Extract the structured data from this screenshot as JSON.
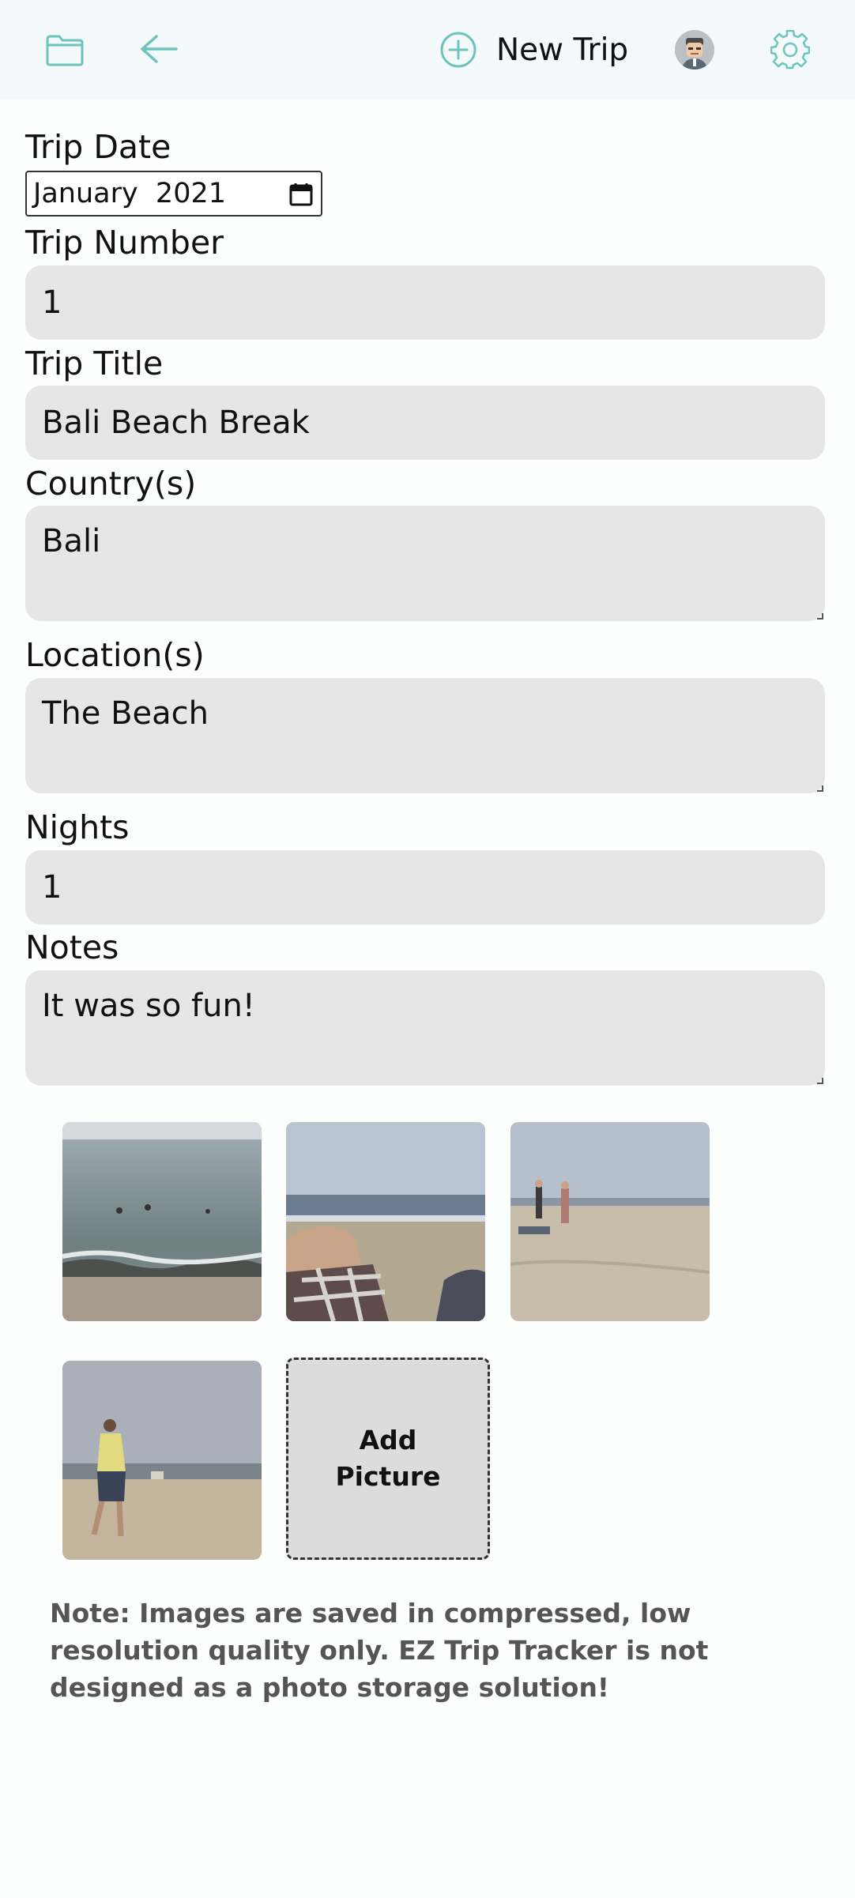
{
  "header": {
    "new_trip_label": "New Trip",
    "icons": [
      "folder-icon",
      "back-arrow-icon",
      "plus-circle-icon",
      "avatar",
      "gear-icon"
    ],
    "accent_color": "#6cc4bd"
  },
  "form": {
    "trip_date": {
      "label": "Trip Date",
      "value": "January  2021"
    },
    "trip_number": {
      "label": "Trip Number",
      "value": "1"
    },
    "trip_title": {
      "label": "Trip Title",
      "value": "Bali Beach Break"
    },
    "countries": {
      "label": "Country(s)",
      "value": "Bali"
    },
    "locations": {
      "label": "Location(s)",
      "value": "The Beach"
    },
    "nights": {
      "label": "Nights",
      "value": "1"
    },
    "notes": {
      "label": "Notes",
      "value": "It was so fun!"
    }
  },
  "gallery": {
    "photos": [
      "beach-waves-photo",
      "beach-legs-photo",
      "beach-walkers-photo",
      "beach-man-photo"
    ],
    "add_picture_label": "Add\nPicture"
  },
  "footer_note": "Note: Images are saved in compressed, low resolution quality only. EZ Trip Tracker is not designed as a photo storage solution!"
}
